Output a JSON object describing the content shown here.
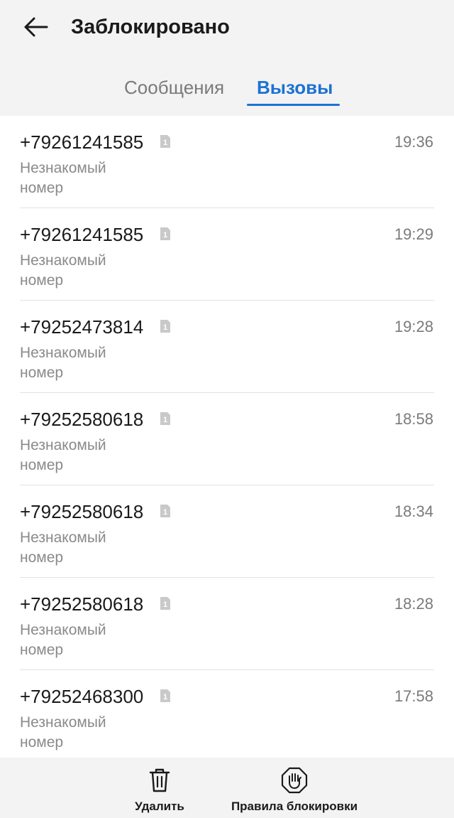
{
  "header": {
    "title": "Заблокировано",
    "back_icon": "arrow-left-icon"
  },
  "tabs": [
    {
      "label": "Сообщения",
      "active": false
    },
    {
      "label": "Вызовы",
      "active": true
    }
  ],
  "colors": {
    "accent": "#1c72d4",
    "background": "#ffffff",
    "header_bg": "#f3f3f3",
    "secondary_text": "#8a8a8a"
  },
  "calls": [
    {
      "number": "+79261241585",
      "description": "Незнакомый номер",
      "time": "19:36",
      "sim_icon": "sim-card-1-icon"
    },
    {
      "number": "+79261241585",
      "description": "Незнакомый номер",
      "time": "19:29",
      "sim_icon": "sim-card-1-icon"
    },
    {
      "number": "+79252473814",
      "description": "Незнакомый номер",
      "time": "19:28",
      "sim_icon": "sim-card-1-icon"
    },
    {
      "number": "+79252580618",
      "description": "Незнакомый номер",
      "time": "18:58",
      "sim_icon": "sim-card-1-icon"
    },
    {
      "number": "+79252580618",
      "description": "Незнакомый номер",
      "time": "18:34",
      "sim_icon": "sim-card-1-icon"
    },
    {
      "number": "+79252580618",
      "description": "Незнакомый номер",
      "time": "18:28",
      "sim_icon": "sim-card-1-icon"
    },
    {
      "number": "+79252468300",
      "description": "Незнакомый номер",
      "time": "17:58",
      "sim_icon": "sim-card-1-icon"
    }
  ],
  "bottom_bar": {
    "delete_label": "Удалить",
    "delete_icon": "trash-icon",
    "rules_label": "Правила блокировки",
    "rules_icon": "block-hand-icon"
  }
}
